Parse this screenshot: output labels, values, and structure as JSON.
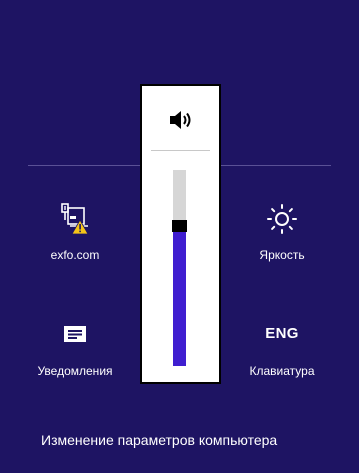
{
  "settings": {
    "network": {
      "label": "exfo.com",
      "icon": "network-warning-icon"
    },
    "brightness": {
      "label": "Яркость",
      "icon": "brightness-icon"
    },
    "notifications": {
      "label": "Уведомления",
      "icon": "notifications-icon"
    },
    "keyboard": {
      "label": "Клавиатура",
      "value": "ENG"
    }
  },
  "volume": {
    "icon": "speaker-icon",
    "level_percent": 73
  },
  "footer": {
    "change_settings": "Изменение параметров компьютера"
  },
  "colors": {
    "background": "#1e1463",
    "accent": "#3f1ed0",
    "warning": "#f5c518"
  }
}
